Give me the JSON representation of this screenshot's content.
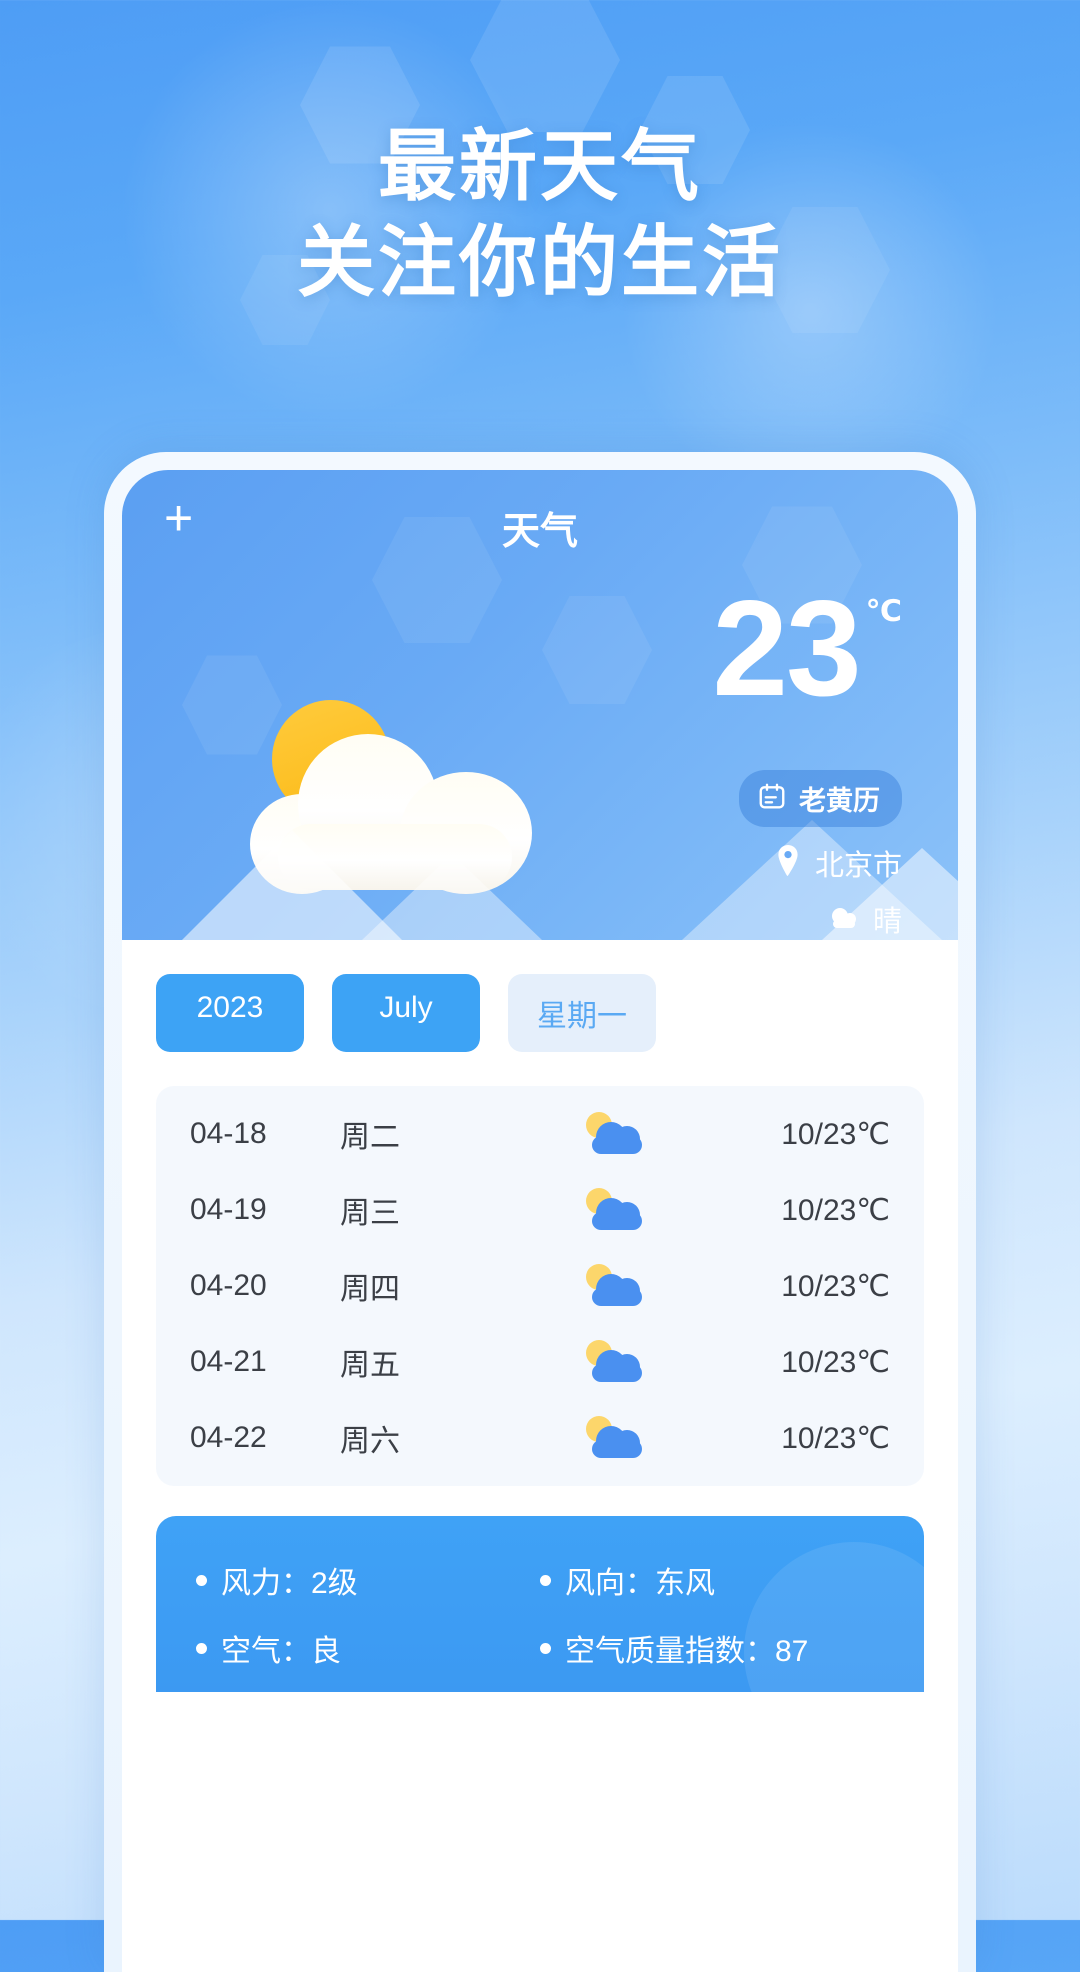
{
  "headline": {
    "line1": "最新天气",
    "line2": "关注你的生活"
  },
  "app": {
    "add_label": "+",
    "title": "天气",
    "temperature": "23",
    "temperature_unit": "℃",
    "almanac_label": "老黄历",
    "almanac_icon": "calendar-icon",
    "location": "北京市",
    "location_icon": "location-pin-icon",
    "condition": "晴",
    "condition_icon": "cloud-icon",
    "hero_icon": "sun-behind-cloud-icon"
  },
  "chips": [
    {
      "label": "2023",
      "active": true
    },
    {
      "label": "July",
      "active": true
    },
    {
      "label": "星期一",
      "active": false
    }
  ],
  "forecast": {
    "rows": [
      {
        "date": "04-18",
        "day": "周二",
        "icon": "sun-behind-cloud-icon",
        "temp": "10/23℃"
      },
      {
        "date": "04-19",
        "day": "周三",
        "icon": "sun-behind-cloud-icon",
        "temp": "10/23℃"
      },
      {
        "date": "04-20",
        "day": "周四",
        "icon": "sun-behind-cloud-icon",
        "temp": "10/23℃"
      },
      {
        "date": "04-21",
        "day": "周五",
        "icon": "sun-behind-cloud-icon",
        "temp": "10/23℃"
      },
      {
        "date": "04-22",
        "day": "周六",
        "icon": "sun-behind-cloud-icon",
        "temp": "10/23℃"
      }
    ]
  },
  "info": {
    "items": [
      {
        "label": "风力：2级"
      },
      {
        "label": "风向：东风"
      },
      {
        "label": "空气：良"
      },
      {
        "label": "空气质量指数：87"
      }
    ]
  },
  "colors": {
    "accent": "#3da3f5",
    "hero_blue": "#69aaf5",
    "chip_muted_bg": "#e5effb",
    "chip_muted_text": "#5aa9f3",
    "forecast_bg": "#f4f8fd",
    "sun_yellow": "#fbb914",
    "text_dark": "#3b3f46"
  }
}
